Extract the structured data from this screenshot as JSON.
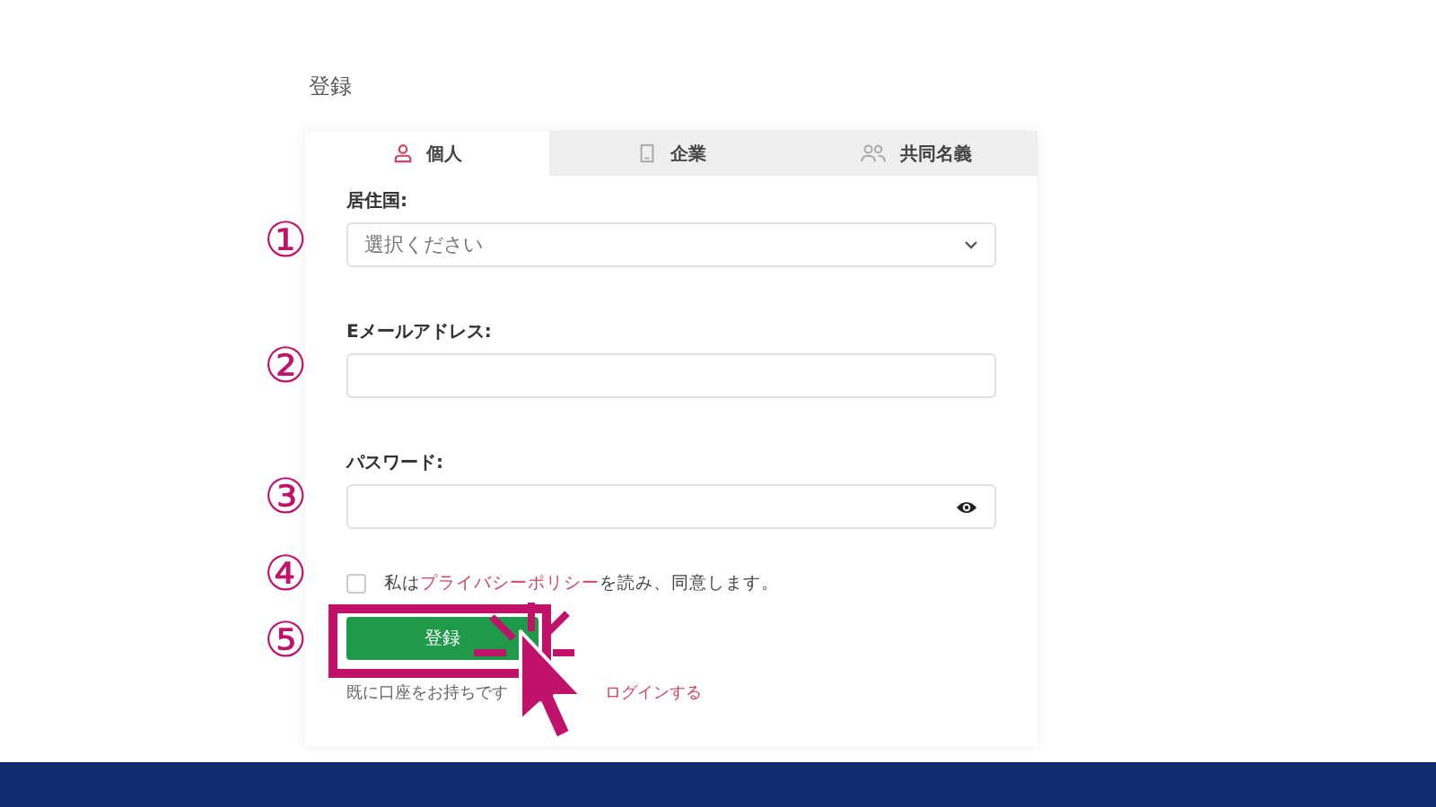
{
  "page_title": "登録",
  "tabs": [
    {
      "label": "個人",
      "kind": "person",
      "selected": true
    },
    {
      "label": "企業",
      "kind": "building",
      "selected": false
    },
    {
      "label": "共同名義",
      "kind": "people",
      "selected": false
    }
  ],
  "form": {
    "country": {
      "label": "居住国:",
      "placeholder": "選択ください"
    },
    "email": {
      "label": "Eメールアドレス:"
    },
    "password": {
      "label": "パスワード:"
    },
    "consent": {
      "checked": false,
      "text_before": "私は",
      "link": "プライバシーポリシー",
      "text_after": "を読み、同意します。"
    },
    "submit": "登録",
    "login_prompt": "既に口座をお持ちです",
    "login_link": "ログインする"
  },
  "annotations": [
    "①",
    "②",
    "③",
    "④",
    "⑤"
  ]
}
